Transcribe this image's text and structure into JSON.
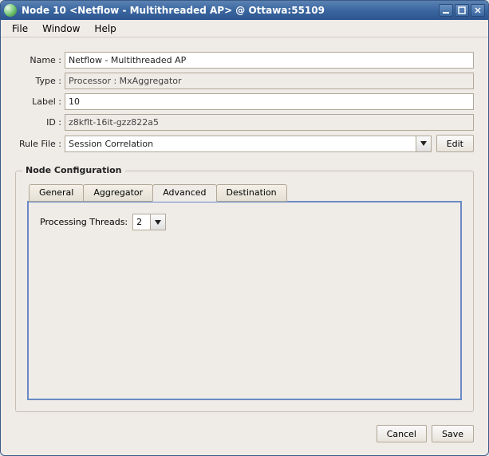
{
  "window": {
    "title": "Node 10 <Netflow - Multithreaded AP> @ Ottawa:55109"
  },
  "menu": {
    "file": "File",
    "window": "Window",
    "help": "Help"
  },
  "form": {
    "name_label": "Name :",
    "name_value": "Netflow - Multithreaded AP",
    "type_label": "Type :",
    "type_value": "Processor : MxAggregator",
    "label_label": "Label :",
    "label_value": "10",
    "id_label": "ID :",
    "id_value": "z8kflt-16it-gzz822a5",
    "rulefile_label": "Rule File :",
    "rulefile_value": "Session Correlation",
    "edit_btn": "Edit"
  },
  "group": {
    "title": "Node Configuration",
    "tabs": {
      "general": "General",
      "aggregator": "Aggregator",
      "advanced": "Advanced",
      "destination": "Destination"
    },
    "advanced_panel": {
      "threads_label": "Processing Threads:",
      "threads_value": "2"
    }
  },
  "footer": {
    "cancel": "Cancel",
    "save": "Save"
  }
}
